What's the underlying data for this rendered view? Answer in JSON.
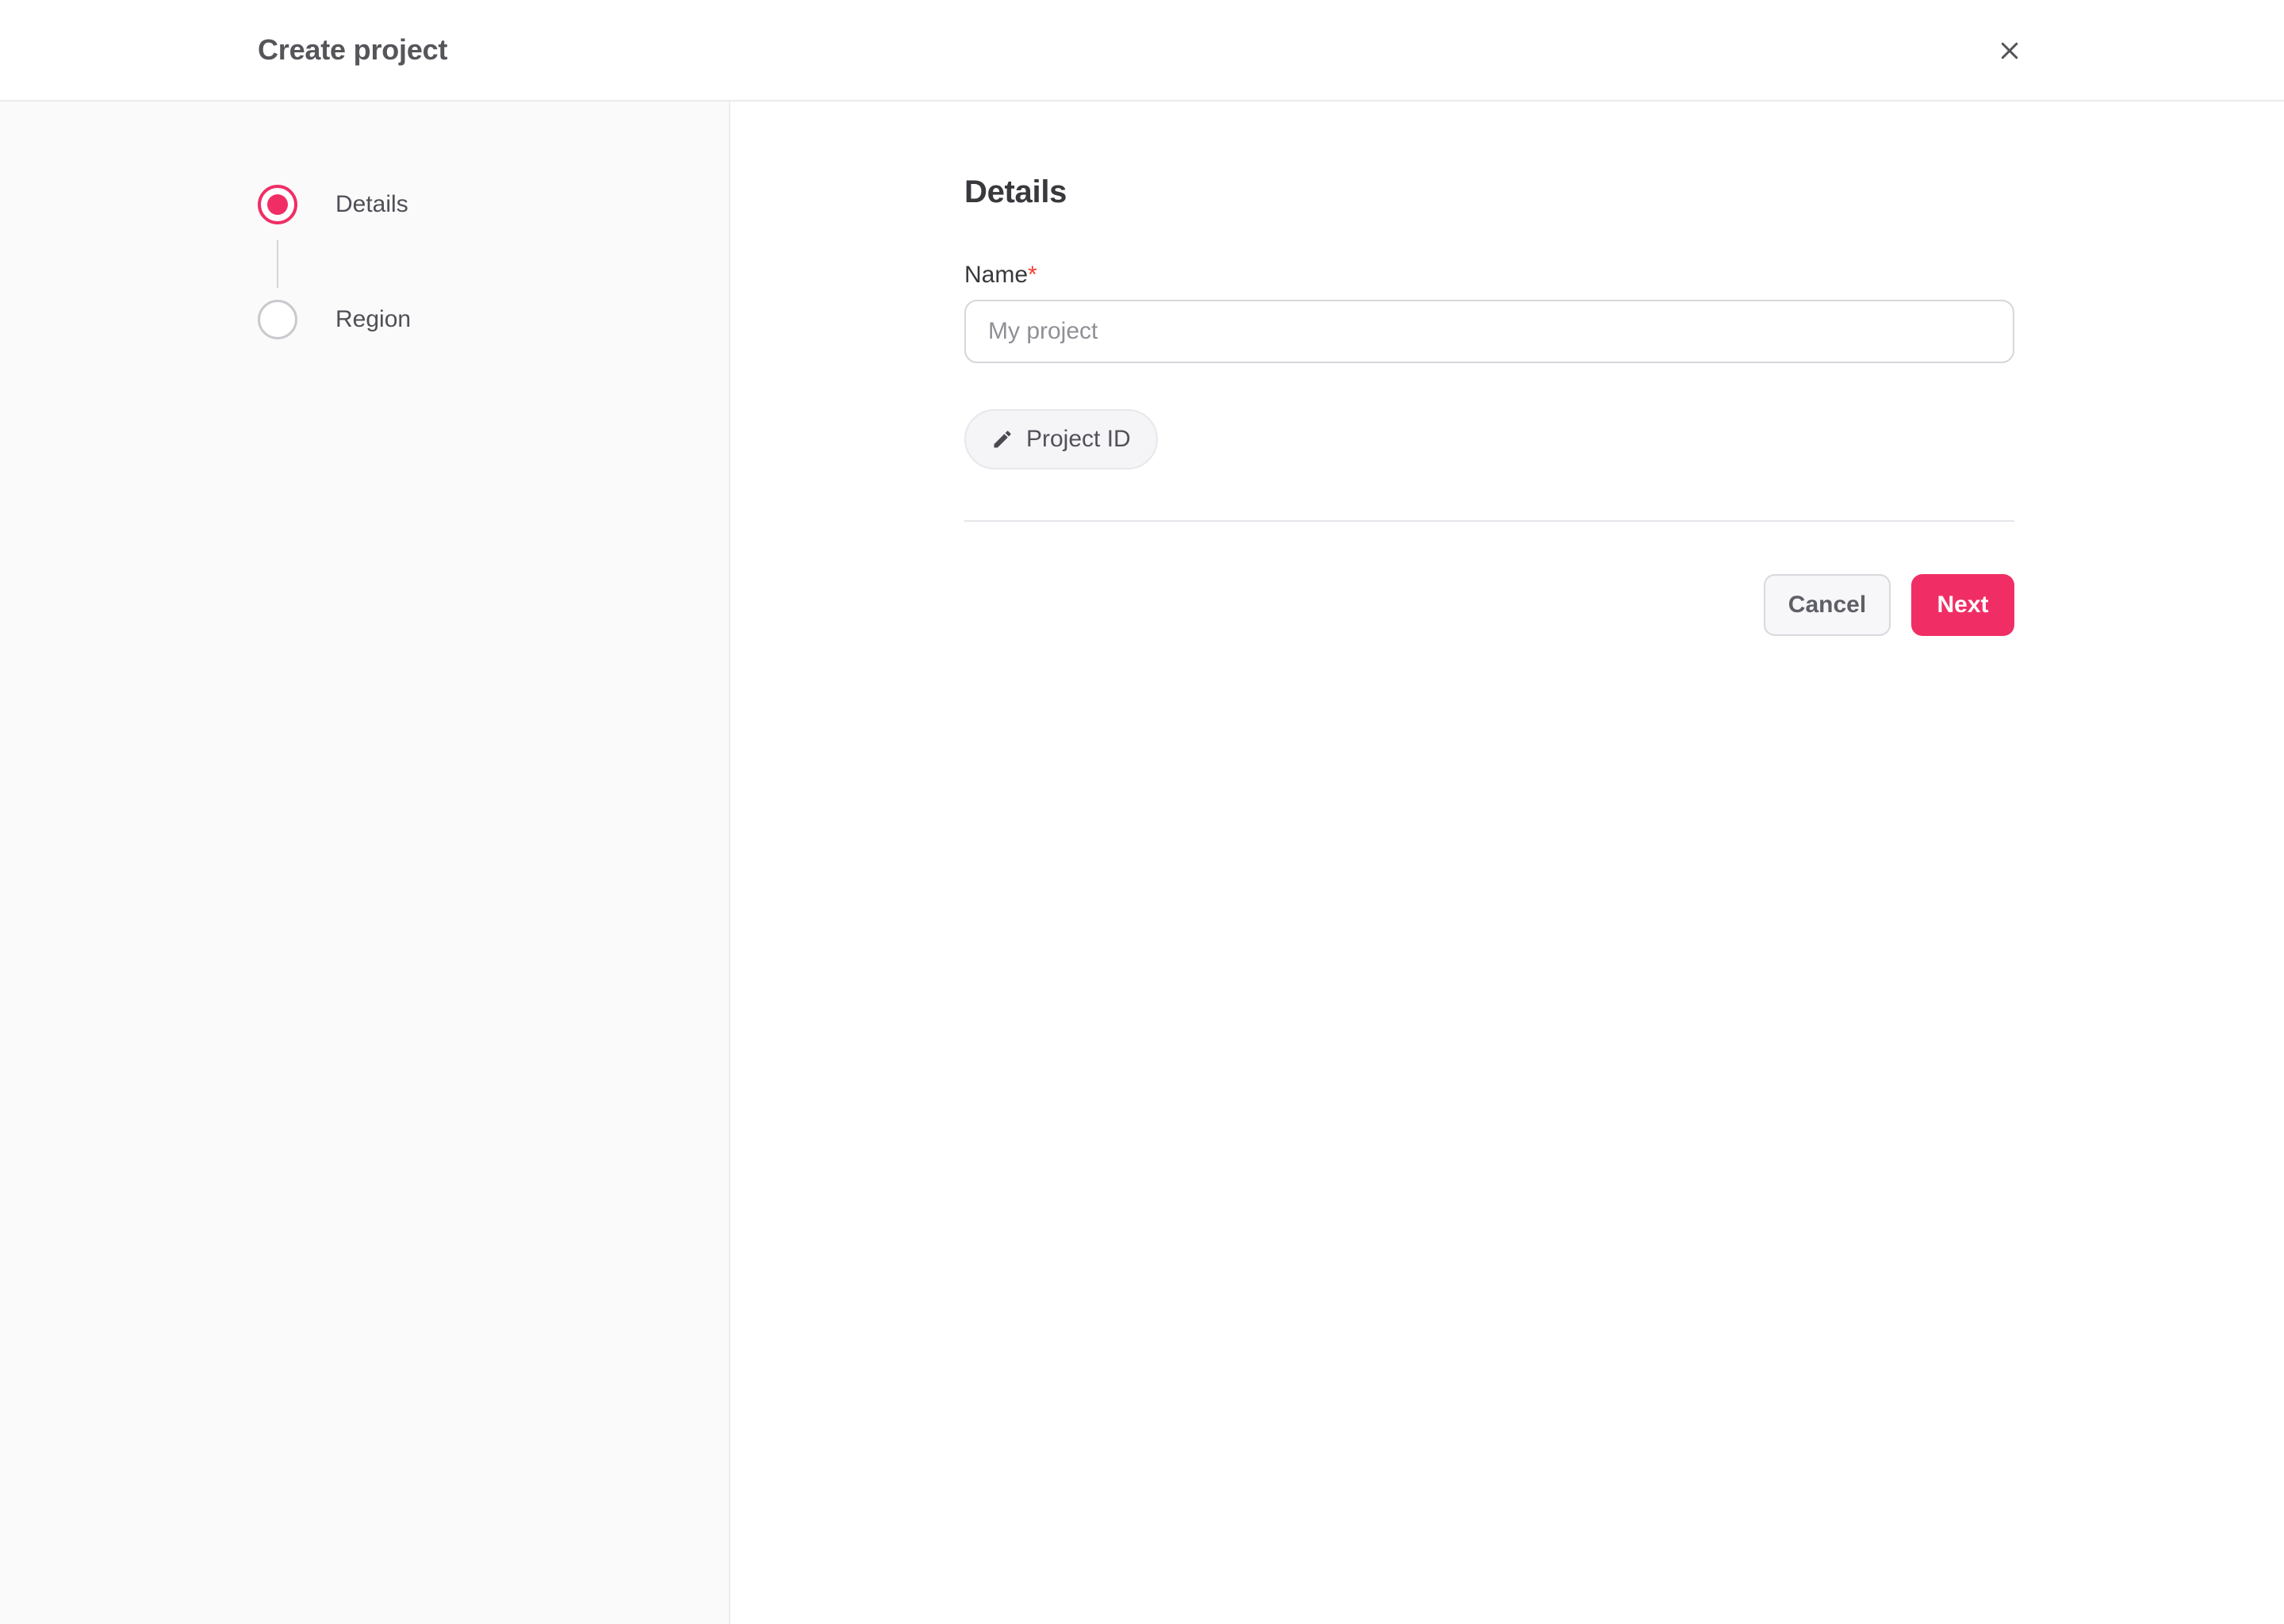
{
  "header": {
    "title": "Create project"
  },
  "stepper": {
    "steps": [
      {
        "label": "Details",
        "state": "current"
      },
      {
        "label": "Region",
        "state": "upcoming"
      }
    ]
  },
  "form": {
    "heading": "Details",
    "name_field": {
      "label": "Name",
      "required_marker": "*",
      "value": "",
      "placeholder": "My project"
    },
    "project_id_button": {
      "label": "Project ID",
      "icon": "edit-pencil-icon"
    }
  },
  "footer": {
    "cancel_label": "Cancel",
    "next_label": "Next"
  },
  "colors": {
    "accent_pink": "#f02e65",
    "required_red": "#f43e31",
    "sidebar_bg": "#fafafb",
    "border": "#ebebee",
    "text_primary": "#38383d",
    "text_secondary": "#55555a",
    "placeholder": "#8f8f96"
  }
}
